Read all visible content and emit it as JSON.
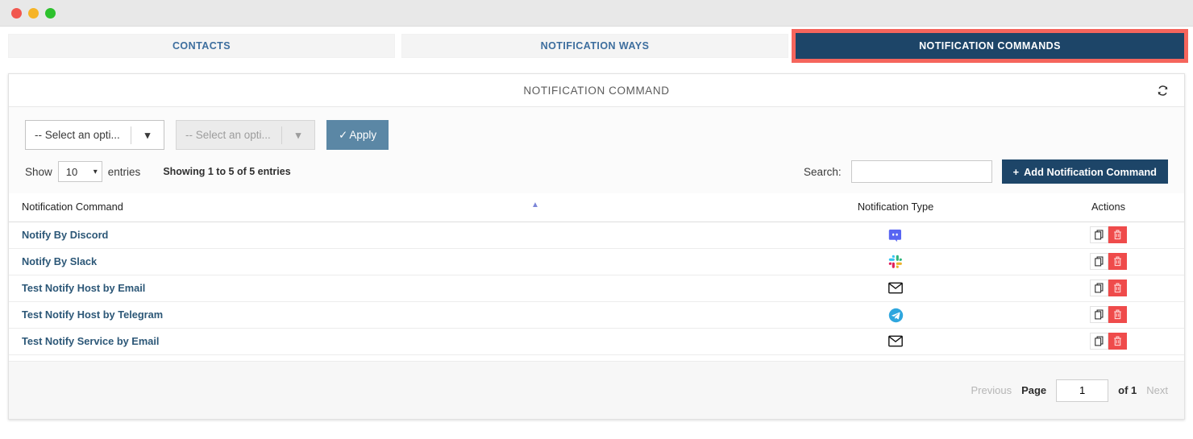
{
  "window": {
    "buttons": [
      "close",
      "minimize",
      "maximize"
    ]
  },
  "tabs": [
    {
      "label": "CONTACTS",
      "active": false
    },
    {
      "label": "NOTIFICATION WAYS",
      "active": false
    },
    {
      "label": "NOTIFICATION COMMANDS",
      "active": true
    }
  ],
  "panel": {
    "title": "NOTIFICATION COMMAND",
    "refresh_icon": "refresh-icon"
  },
  "filters": {
    "select_one": {
      "value": "-- Select an opti...",
      "disabled": false
    },
    "select_two": {
      "value": "-- Select an opti...",
      "disabled": true
    },
    "apply_label": "Apply"
  },
  "controls": {
    "show_label": "Show",
    "page_length": "10",
    "entries_label": "entries",
    "info": "Showing 1 to 5 of 5 entries",
    "search_label": "Search:",
    "search_value": "",
    "search_placeholder": "",
    "add_label": "Add Notification Command",
    "add_plus": "+"
  },
  "table": {
    "columns": [
      "Notification Command",
      "Notification Type",
      "Actions"
    ],
    "sort_column": "Notification Command",
    "sort_direction": "asc",
    "rows": [
      {
        "name": "Notify By Discord",
        "type_icon": "discord-icon",
        "type_name": "Discord"
      },
      {
        "name": "Notify By Slack",
        "type_icon": "slack-icon",
        "type_name": "Slack"
      },
      {
        "name": "Test Notify Host by Email",
        "type_icon": "email-icon",
        "type_name": "Email"
      },
      {
        "name": "Test Notify Host by Telegram",
        "type_icon": "telegram-icon",
        "type_name": "Telegram"
      },
      {
        "name": "Test Notify Service by Email",
        "type_icon": "email-icon",
        "type_name": "Email"
      }
    ],
    "row_actions": {
      "copy": "copy-icon",
      "delete": "trash-icon"
    }
  },
  "pagination": {
    "previous": "Previous",
    "page_label": "Page",
    "page_value": "1",
    "of_label": "of 1",
    "next": "Next"
  },
  "colors": {
    "accent_dark": "#1d4568",
    "highlight_red": "#f5655c",
    "apply_blue": "#5b87a5",
    "delete_red": "#ef4b4b",
    "link_blue": "#2c5777",
    "tab_text": "#3d6e9e",
    "sort_arrow": "#7b85d8"
  }
}
